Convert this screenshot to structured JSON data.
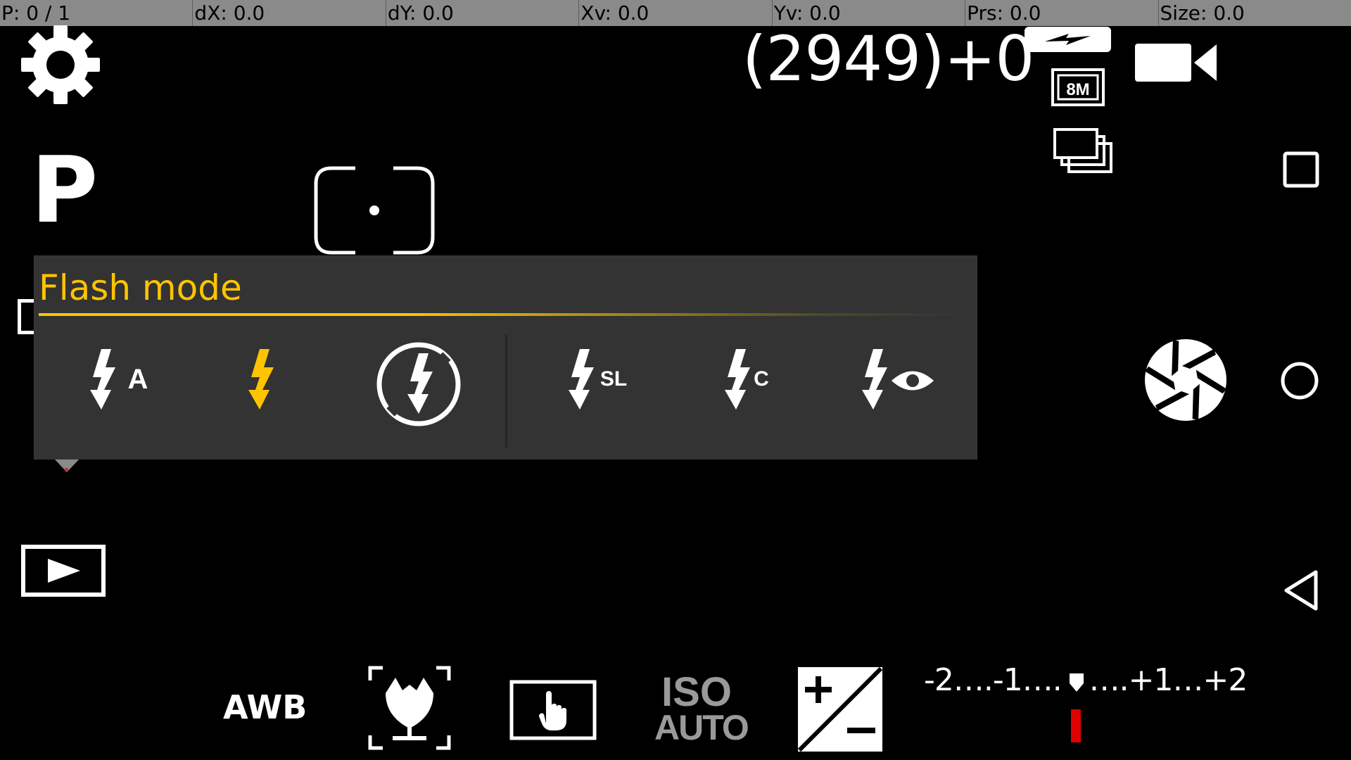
{
  "debug_bar": {
    "p": "P: 0 / 1",
    "dx": "dX: 0.0",
    "dy": "dY: 0.0",
    "xv": "Xv: 0.0",
    "yv": "Yv: 0.0",
    "prs": "Prs: 0.0",
    "size": "Size: 0.0"
  },
  "camera": {
    "shot_counter": "(2949)+0",
    "mode": "P",
    "resolution_badge": "8M",
    "white_balance": "AWB",
    "iso_line1": "ISO",
    "iso_line2": "AUTO",
    "ev_scale": "-2….-1….   ….+1…+2"
  },
  "flash_popup": {
    "title": "Flash mode",
    "selected_index": 1,
    "options": [
      {
        "icon": "flash-auto-icon",
        "label": "A"
      },
      {
        "icon": "flash-on-icon",
        "label": ""
      },
      {
        "icon": "flash-off-icon",
        "label": ""
      },
      {
        "icon": "flash-slow-sync-icon",
        "label": "SL"
      },
      {
        "icon": "flash-curtain-icon",
        "label": "C"
      },
      {
        "icon": "flash-red-eye-icon",
        "label": ""
      }
    ]
  },
  "colors": {
    "accent": "#ffc400",
    "popup_bg": "#333333",
    "ev_indicator": "#e00000",
    "iso_gray": "#9a9a9a"
  }
}
